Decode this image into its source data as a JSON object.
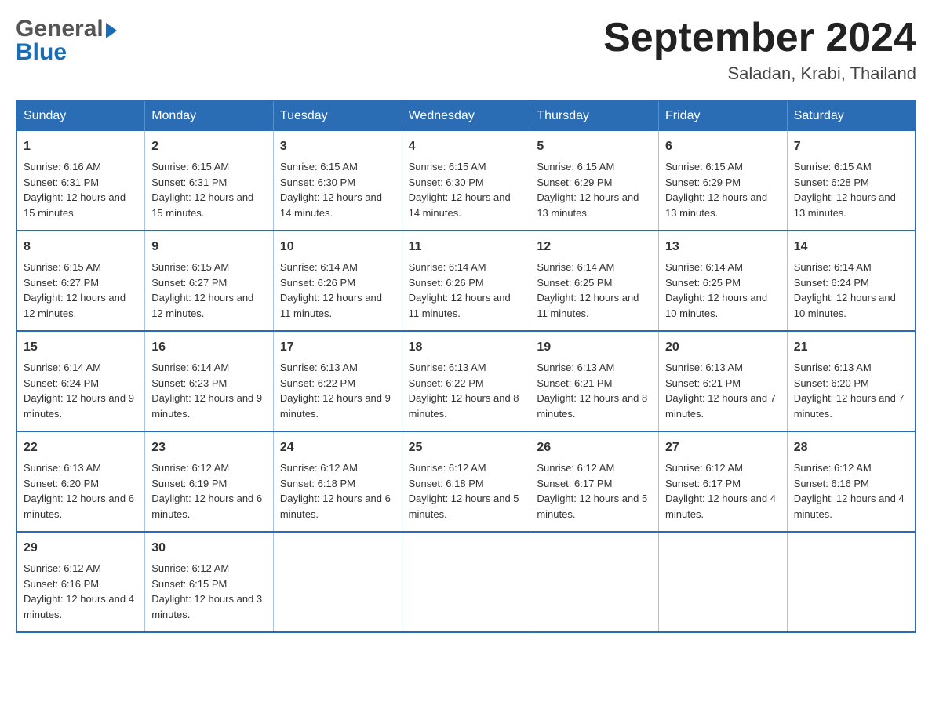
{
  "header": {
    "logo_general": "General",
    "logo_blue": "Blue",
    "month_year": "September 2024",
    "location": "Saladan, Krabi, Thailand"
  },
  "days_of_week": [
    "Sunday",
    "Monday",
    "Tuesday",
    "Wednesday",
    "Thursday",
    "Friday",
    "Saturday"
  ],
  "weeks": [
    [
      {
        "day": "1",
        "sunrise": "Sunrise: 6:16 AM",
        "sunset": "Sunset: 6:31 PM",
        "daylight": "Daylight: 12 hours and 15 minutes."
      },
      {
        "day": "2",
        "sunrise": "Sunrise: 6:15 AM",
        "sunset": "Sunset: 6:31 PM",
        "daylight": "Daylight: 12 hours and 15 minutes."
      },
      {
        "day": "3",
        "sunrise": "Sunrise: 6:15 AM",
        "sunset": "Sunset: 6:30 PM",
        "daylight": "Daylight: 12 hours and 14 minutes."
      },
      {
        "day": "4",
        "sunrise": "Sunrise: 6:15 AM",
        "sunset": "Sunset: 6:30 PM",
        "daylight": "Daylight: 12 hours and 14 minutes."
      },
      {
        "day": "5",
        "sunrise": "Sunrise: 6:15 AM",
        "sunset": "Sunset: 6:29 PM",
        "daylight": "Daylight: 12 hours and 13 minutes."
      },
      {
        "day": "6",
        "sunrise": "Sunrise: 6:15 AM",
        "sunset": "Sunset: 6:29 PM",
        "daylight": "Daylight: 12 hours and 13 minutes."
      },
      {
        "day": "7",
        "sunrise": "Sunrise: 6:15 AM",
        "sunset": "Sunset: 6:28 PM",
        "daylight": "Daylight: 12 hours and 13 minutes."
      }
    ],
    [
      {
        "day": "8",
        "sunrise": "Sunrise: 6:15 AM",
        "sunset": "Sunset: 6:27 PM",
        "daylight": "Daylight: 12 hours and 12 minutes."
      },
      {
        "day": "9",
        "sunrise": "Sunrise: 6:15 AM",
        "sunset": "Sunset: 6:27 PM",
        "daylight": "Daylight: 12 hours and 12 minutes."
      },
      {
        "day": "10",
        "sunrise": "Sunrise: 6:14 AM",
        "sunset": "Sunset: 6:26 PM",
        "daylight": "Daylight: 12 hours and 11 minutes."
      },
      {
        "day": "11",
        "sunrise": "Sunrise: 6:14 AM",
        "sunset": "Sunset: 6:26 PM",
        "daylight": "Daylight: 12 hours and 11 minutes."
      },
      {
        "day": "12",
        "sunrise": "Sunrise: 6:14 AM",
        "sunset": "Sunset: 6:25 PM",
        "daylight": "Daylight: 12 hours and 11 minutes."
      },
      {
        "day": "13",
        "sunrise": "Sunrise: 6:14 AM",
        "sunset": "Sunset: 6:25 PM",
        "daylight": "Daylight: 12 hours and 10 minutes."
      },
      {
        "day": "14",
        "sunrise": "Sunrise: 6:14 AM",
        "sunset": "Sunset: 6:24 PM",
        "daylight": "Daylight: 12 hours and 10 minutes."
      }
    ],
    [
      {
        "day": "15",
        "sunrise": "Sunrise: 6:14 AM",
        "sunset": "Sunset: 6:24 PM",
        "daylight": "Daylight: 12 hours and 9 minutes."
      },
      {
        "day": "16",
        "sunrise": "Sunrise: 6:14 AM",
        "sunset": "Sunset: 6:23 PM",
        "daylight": "Daylight: 12 hours and 9 minutes."
      },
      {
        "day": "17",
        "sunrise": "Sunrise: 6:13 AM",
        "sunset": "Sunset: 6:22 PM",
        "daylight": "Daylight: 12 hours and 9 minutes."
      },
      {
        "day": "18",
        "sunrise": "Sunrise: 6:13 AM",
        "sunset": "Sunset: 6:22 PM",
        "daylight": "Daylight: 12 hours and 8 minutes."
      },
      {
        "day": "19",
        "sunrise": "Sunrise: 6:13 AM",
        "sunset": "Sunset: 6:21 PM",
        "daylight": "Daylight: 12 hours and 8 minutes."
      },
      {
        "day": "20",
        "sunrise": "Sunrise: 6:13 AM",
        "sunset": "Sunset: 6:21 PM",
        "daylight": "Daylight: 12 hours and 7 minutes."
      },
      {
        "day": "21",
        "sunrise": "Sunrise: 6:13 AM",
        "sunset": "Sunset: 6:20 PM",
        "daylight": "Daylight: 12 hours and 7 minutes."
      }
    ],
    [
      {
        "day": "22",
        "sunrise": "Sunrise: 6:13 AM",
        "sunset": "Sunset: 6:20 PM",
        "daylight": "Daylight: 12 hours and 6 minutes."
      },
      {
        "day": "23",
        "sunrise": "Sunrise: 6:12 AM",
        "sunset": "Sunset: 6:19 PM",
        "daylight": "Daylight: 12 hours and 6 minutes."
      },
      {
        "day": "24",
        "sunrise": "Sunrise: 6:12 AM",
        "sunset": "Sunset: 6:18 PM",
        "daylight": "Daylight: 12 hours and 6 minutes."
      },
      {
        "day": "25",
        "sunrise": "Sunrise: 6:12 AM",
        "sunset": "Sunset: 6:18 PM",
        "daylight": "Daylight: 12 hours and 5 minutes."
      },
      {
        "day": "26",
        "sunrise": "Sunrise: 6:12 AM",
        "sunset": "Sunset: 6:17 PM",
        "daylight": "Daylight: 12 hours and 5 minutes."
      },
      {
        "day": "27",
        "sunrise": "Sunrise: 6:12 AM",
        "sunset": "Sunset: 6:17 PM",
        "daylight": "Daylight: 12 hours and 4 minutes."
      },
      {
        "day": "28",
        "sunrise": "Sunrise: 6:12 AM",
        "sunset": "Sunset: 6:16 PM",
        "daylight": "Daylight: 12 hours and 4 minutes."
      }
    ],
    [
      {
        "day": "29",
        "sunrise": "Sunrise: 6:12 AM",
        "sunset": "Sunset: 6:16 PM",
        "daylight": "Daylight: 12 hours and 4 minutes."
      },
      {
        "day": "30",
        "sunrise": "Sunrise: 6:12 AM",
        "sunset": "Sunset: 6:15 PM",
        "daylight": "Daylight: 12 hours and 3 minutes."
      },
      {
        "day": "",
        "sunrise": "",
        "sunset": "",
        "daylight": ""
      },
      {
        "day": "",
        "sunrise": "",
        "sunset": "",
        "daylight": ""
      },
      {
        "day": "",
        "sunrise": "",
        "sunset": "",
        "daylight": ""
      },
      {
        "day": "",
        "sunrise": "",
        "sunset": "",
        "daylight": ""
      },
      {
        "day": "",
        "sunrise": "",
        "sunset": "",
        "daylight": ""
      }
    ]
  ]
}
